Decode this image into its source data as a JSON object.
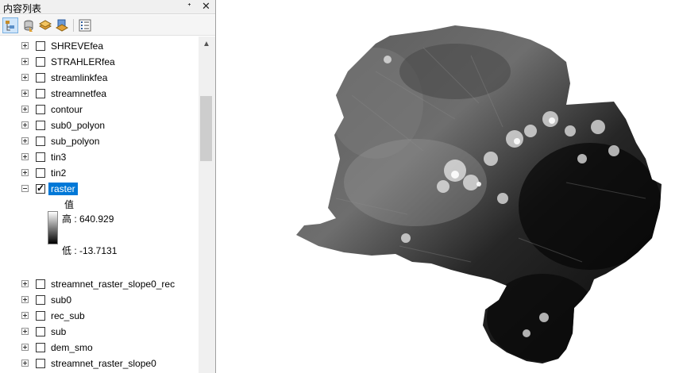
{
  "toc": {
    "title": "内容列表",
    "pin_glyph": "ᐩ",
    "close_glyph": "✕",
    "toolbar": [
      {
        "name": "list-by-drawing-order-button",
        "active": true
      },
      {
        "name": "list-by-source-button",
        "active": false
      },
      {
        "name": "list-by-visibility-button",
        "active": false
      },
      {
        "name": "list-by-selection-button",
        "active": false
      },
      {
        "name": "options-button",
        "active": false
      }
    ],
    "layers_top": [
      {
        "label": "SHREVEfea",
        "checked": false
      },
      {
        "label": "STRAHLERfea",
        "checked": false
      },
      {
        "label": "streamlinkfea",
        "checked": false
      },
      {
        "label": "streamnetfea",
        "checked": false
      },
      {
        "label": "contour",
        "checked": false
      },
      {
        "label": "sub0_polyon",
        "checked": false
      },
      {
        "label": "sub_polyon",
        "checked": false
      },
      {
        "label": "tin3",
        "checked": false
      },
      {
        "label": "tin2",
        "checked": false
      }
    ],
    "raster_layer": {
      "label": "raster",
      "checked": true,
      "legend_title": "值",
      "high": "高 : 640.929",
      "low": "低 : -13.7131"
    },
    "layers_bottom": [
      {
        "label": "streamnet_raster_slope0_rec",
        "checked": false
      },
      {
        "label": "sub0",
        "checked": false
      },
      {
        "label": "rec_sub",
        "checked": false
      },
      {
        "label": "sub",
        "checked": false
      },
      {
        "label": "dem_smo",
        "checked": false
      },
      {
        "label": "streamnet_raster_slope0",
        "checked": false
      }
    ]
  },
  "map": {
    "raster_high_color": "#ffffff",
    "raster_low_color": "#000000",
    "selection_color": "#0078d7"
  }
}
